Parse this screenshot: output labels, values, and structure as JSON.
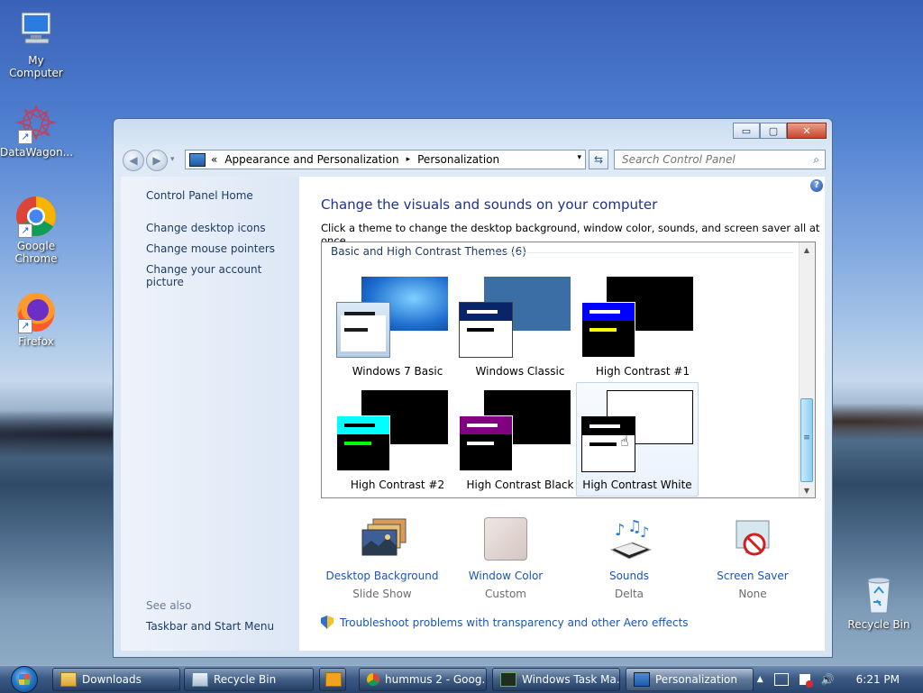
{
  "desktop": {
    "icons": [
      {
        "label": "My Computer"
      },
      {
        "label": "DataWagon..."
      },
      {
        "label": "Google Chrome"
      },
      {
        "label": "Firefox"
      },
      {
        "label": "Recycle Bin"
      }
    ]
  },
  "window": {
    "buttons": {
      "minimize": "▭",
      "maximize": "▢",
      "close": "✕"
    },
    "nav": {
      "back": "◀",
      "forward": "▶",
      "recent": "▾"
    },
    "address": {
      "prefix": "«",
      "crumb1": "Appearance and Personalization",
      "sep": "▸",
      "crumb2": "Personalization",
      "dropdown": "▾"
    },
    "refresh": "⇆",
    "search": {
      "placeholder": "Search Control Panel",
      "icon": "⌕"
    }
  },
  "leftpane": {
    "home": "Control Panel Home",
    "links": [
      "Change desktop icons",
      "Change mouse pointers",
      "Change your account picture"
    ],
    "see_also": "See also",
    "see_also_link": "Taskbar and Start Menu"
  },
  "main": {
    "title": "Change the visuals and sounds on your computer",
    "subtitle": "Click a theme to change the desktop background, window color, sounds, and screen saver all at once.",
    "help": "?",
    "group_label": "Basic and High Contrast Themes (6)",
    "scroll": {
      "up": "▲",
      "down": "▼",
      "grip": "≡"
    },
    "themes": [
      {
        "label": "Windows 7 Basic"
      },
      {
        "label": "Windows Classic"
      },
      {
        "label": "High Contrast #1"
      },
      {
        "label": "High Contrast #2"
      },
      {
        "label": "High Contrast Black"
      },
      {
        "label": "High Contrast White",
        "selected": true
      }
    ],
    "tools": [
      {
        "name": "Desktop Background",
        "value": "Slide Show"
      },
      {
        "name": "Window Color",
        "value": "Custom"
      },
      {
        "name": "Sounds",
        "value": "Delta"
      },
      {
        "name": "Screen Saver",
        "value": "None"
      }
    ],
    "troubleshoot": "Troubleshoot problems with transparency and other Aero effects"
  },
  "taskbar": {
    "items": [
      {
        "label": "Downloads"
      },
      {
        "label": "Recycle Bin"
      },
      {
        "label": ""
      },
      {
        "label": "hummus 2 - Goog..."
      },
      {
        "label": "Windows Task Ma..."
      },
      {
        "label": "Personalization",
        "active": true
      }
    ],
    "tray": {
      "chevron": "▲",
      "volume": "🔊",
      "clock": "6:21 PM"
    }
  }
}
